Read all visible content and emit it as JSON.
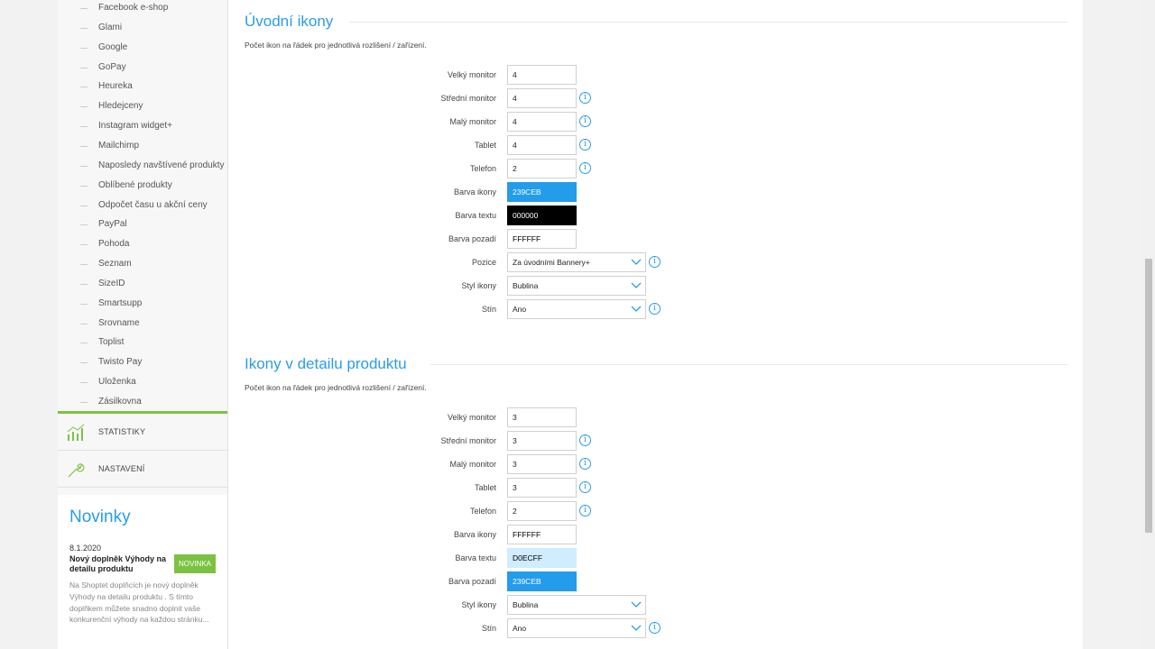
{
  "sidebar": {
    "subnav": [
      "Facebook e-shop",
      "Glami",
      "Google",
      "GoPay",
      "Heureka",
      "Hledejceny",
      "Instagram widget+",
      "Mailchimp",
      "Naposledy navštívené produkty",
      "Oblíbené produkty",
      "Odpočet času u akční ceny",
      "PayPal",
      "Pohoda",
      "Seznam",
      "SizeID",
      "Smartsupp",
      "Srovname",
      "Toplist",
      "Twisto Pay",
      "Uloženka",
      "Zásilkovna"
    ],
    "nav": [
      {
        "label": "STATISTIKY",
        "icon": "bar-chart-icon"
      },
      {
        "label": "NASTAVENÍ",
        "icon": "wrench-icon"
      }
    ],
    "news": {
      "title": "Novinky",
      "date": "8.1.2020",
      "headline": "Nový doplněk Výhody na detailu produktu",
      "badge": "NOVINKA",
      "body": "Na Shoptet doplňcích je nový doplněk Výhody na detailu produktu . S tímto doplňkem můžete snadno doplnit vaše konkurenční výhody na každou stránku..."
    }
  },
  "sections": [
    {
      "title": "Úvodní ikony",
      "desc": "Počet ikon na řádek pro jednotlivá rozlišení / zařízení.",
      "fields": [
        {
          "label": "Velký monitor",
          "value": "4",
          "type": "text",
          "info": false
        },
        {
          "label": "Střední monitor",
          "value": "4",
          "type": "text",
          "info": true
        },
        {
          "label": "Malý monitor",
          "value": "4",
          "type": "text",
          "info": true
        },
        {
          "label": "Tablet",
          "value": "4",
          "type": "text",
          "info": true
        },
        {
          "label": "Telefon",
          "value": "2",
          "type": "text",
          "info": true
        },
        {
          "label": "Barva ikony",
          "value": "239CEB",
          "type": "color",
          "bg": "#239CEB",
          "fg": "#FFFFFF",
          "info": false
        },
        {
          "label": "Barva textu",
          "value": "000000",
          "type": "color",
          "bg": "#000000",
          "fg": "#FFFFFF",
          "info": false
        },
        {
          "label": "Barva pozadí",
          "value": "FFFFFF",
          "type": "color",
          "bg": "#FFFFFF",
          "fg": "#000000",
          "info": false
        },
        {
          "label": "Pozice",
          "value": "Za úvodními Bannery+",
          "type": "select",
          "info": true
        },
        {
          "label": "Styl ikony",
          "value": "Bublina",
          "type": "select",
          "info": false
        },
        {
          "label": "Stín",
          "value": "Ano",
          "type": "select",
          "info": true
        }
      ]
    },
    {
      "title": "Ikony v detailu produktu",
      "desc": "Počet ikon na řádek pro jednotlivá rozlišení / zařízení.",
      "fields": [
        {
          "label": "Velký monitor",
          "value": "3",
          "type": "text",
          "info": false
        },
        {
          "label": "Střední monitor",
          "value": "3",
          "type": "text",
          "info": true
        },
        {
          "label": "Malý monitor",
          "value": "3",
          "type": "text",
          "info": true
        },
        {
          "label": "Tablet",
          "value": "3",
          "type": "text",
          "info": true
        },
        {
          "label": "Telefon",
          "value": "2",
          "type": "text",
          "info": true
        },
        {
          "label": "Barva ikony",
          "value": "FFFFFF",
          "type": "color",
          "bg": "#FFFFFF",
          "fg": "#000000",
          "info": false
        },
        {
          "label": "Barva textu",
          "value": "D0ECFF",
          "type": "color",
          "bg": "#D0ECFF",
          "fg": "#000000",
          "info": false
        },
        {
          "label": "Barva pozadí",
          "value": "239CEB",
          "type": "color",
          "bg": "#239CEB",
          "fg": "#FFFFFF",
          "info": false
        },
        {
          "label": "Styl ikony",
          "value": "Bublina",
          "type": "select",
          "info": false
        },
        {
          "label": "Stín",
          "value": "Ano",
          "type": "select",
          "info": true
        }
      ]
    }
  ],
  "colors": {
    "accent": "#2A9CE8",
    "green": "#7CC242"
  }
}
